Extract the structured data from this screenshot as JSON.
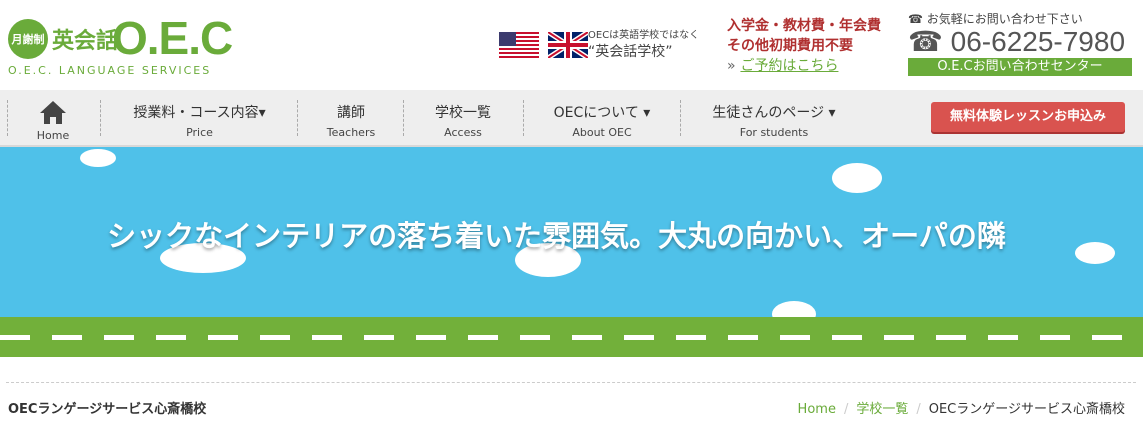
{
  "logo": {
    "badge": "月謝制",
    "jp": "英会話",
    "brand": "O.E.C",
    "sub": "O.E.C. LANGUAGE SERVICES"
  },
  "flags_note": {
    "line1": "OECは英語学校ではなく",
    "line2": "“英会話学校”"
  },
  "fees": {
    "line1": "入学金・教材費・年会費",
    "line2": "その他初期費用不要",
    "arrow": "»",
    "link": "ご予約はこちら"
  },
  "contact": {
    "top": "☎ お気軽にお問い合わせ下さい",
    "phone": "☎ 06-6225-7980",
    "bar": "O.E.Cお問い合わせセンター"
  },
  "nav": {
    "home": {
      "en": "Home"
    },
    "items": [
      {
        "ja": "授業料・コース内容▾",
        "en": "Price"
      },
      {
        "ja": "講師",
        "en": "Teachers"
      },
      {
        "ja": "学校一覧",
        "en": "Access"
      },
      {
        "ja": "OECについて ▾",
        "en": "About OEC"
      },
      {
        "ja": "生徒さんのページ ▾",
        "en": "For students"
      }
    ],
    "cta": "無料体験レッスンお申込み"
  },
  "hero": {
    "text": "シックなインテリアの落ち着いた雰囲気。大丸の向かい、オーパの隣"
  },
  "page": {
    "title": "OECランゲージサービス心斎橋校"
  },
  "breadcrumb": {
    "home": "Home",
    "list": "学校一覧",
    "current": "OECランゲージサービス心斎橋校",
    "sep": "/"
  },
  "colors": {
    "brand_green": "#6aab3a",
    "sky": "#4fc1e9",
    "cta_red": "#d9534f",
    "fee_red": "#b03030"
  }
}
